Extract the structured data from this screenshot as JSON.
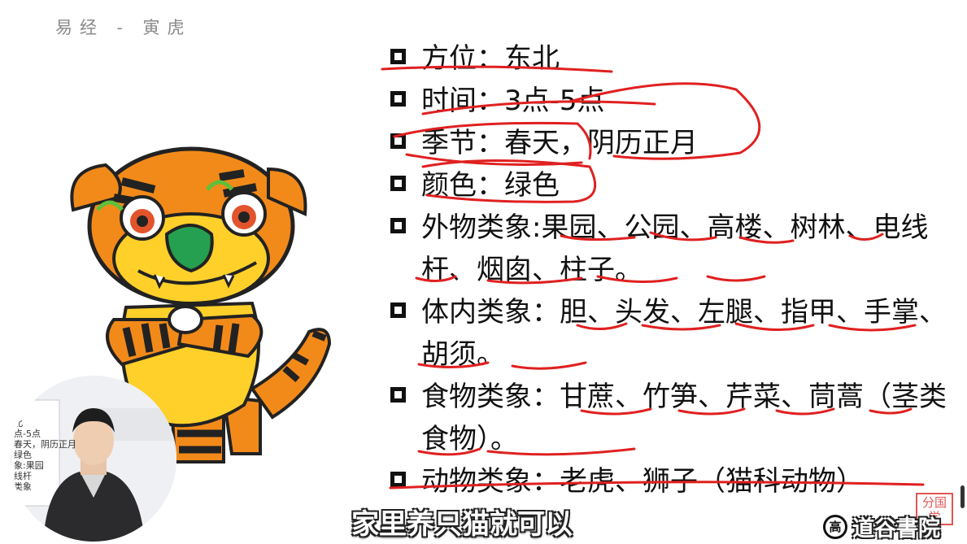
{
  "slide": {
    "header": "易经 - 寅虎",
    "bullets": [
      {
        "label": "方位",
        "text": "方位：东北"
      },
      {
        "label": "时间",
        "text": "时间：3点-5点"
      },
      {
        "label": "季节",
        "text": "季节：春天，阴历正月"
      },
      {
        "label": "颜色",
        "text": "颜色：绿色"
      },
      {
        "label": "外物类象",
        "text": "外物类象:果园、公园、高楼、树林、电线杆、烟囱、柱子。"
      },
      {
        "label": "体内类象",
        "text": "体内类象：胆、头发、左腿、指甲、手掌、胡须。"
      },
      {
        "label": "食物类象",
        "text": "食物类象：甘蔗、竹笋、芹菜、茼蒿（茎类食物）。"
      },
      {
        "label": "动物类象",
        "text": "动物类象：老虎、狮子（猫科动物）"
      }
    ]
  },
  "illustration": {
    "subject": "cartoon tiger",
    "icon": "tiger-illustration"
  },
  "webcam": {
    "monitor_lines": [
      "北",
      "点-5点",
      "春天，阴历正月",
      "绿色",
      "象:果园",
      "线杆",
      "类象"
    ]
  },
  "subtitle": "家里养只猫就可以",
  "branding": {
    "logo_text": "道谷書院",
    "logo_icon_char": "高",
    "seal_text": "分国学"
  },
  "colors": {
    "annotation": "#e02020",
    "text": "#111111",
    "header": "#8a8a8a"
  }
}
